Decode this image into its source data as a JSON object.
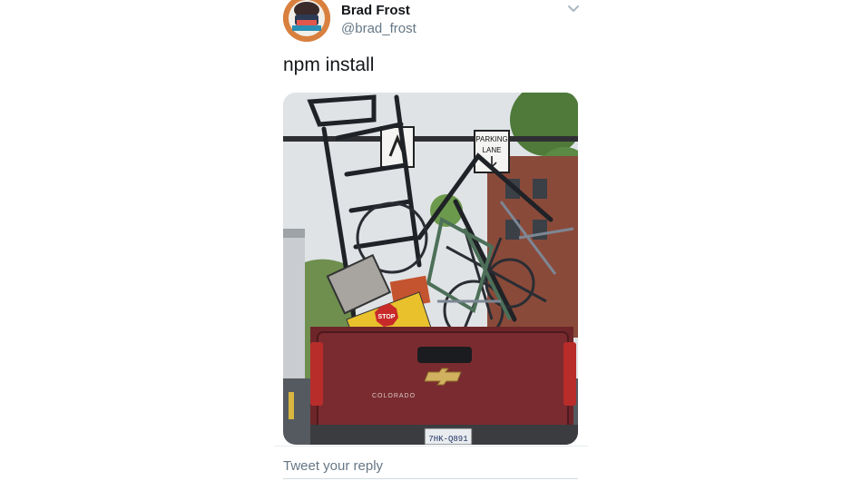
{
  "tweet": {
    "author": {
      "display_name": "Brad Frost",
      "handle": "@brad_frost",
      "avatar": "avatar-photo"
    },
    "menu_icon": "chevron-down-icon",
    "text": "npm install",
    "media": {
      "sign_parking_line1": "PARKING",
      "sign_parking_line2": "LANE",
      "stop_sign_text": "STOP",
      "tailgate_text": "COLORADO",
      "license_plate": "7HK-Q891"
    }
  },
  "reply": {
    "placeholder": "Tweet your reply"
  },
  "colors": {
    "text_primary": "#14171a",
    "text_secondary": "#657786",
    "truck_red": "#7a2b30"
  }
}
